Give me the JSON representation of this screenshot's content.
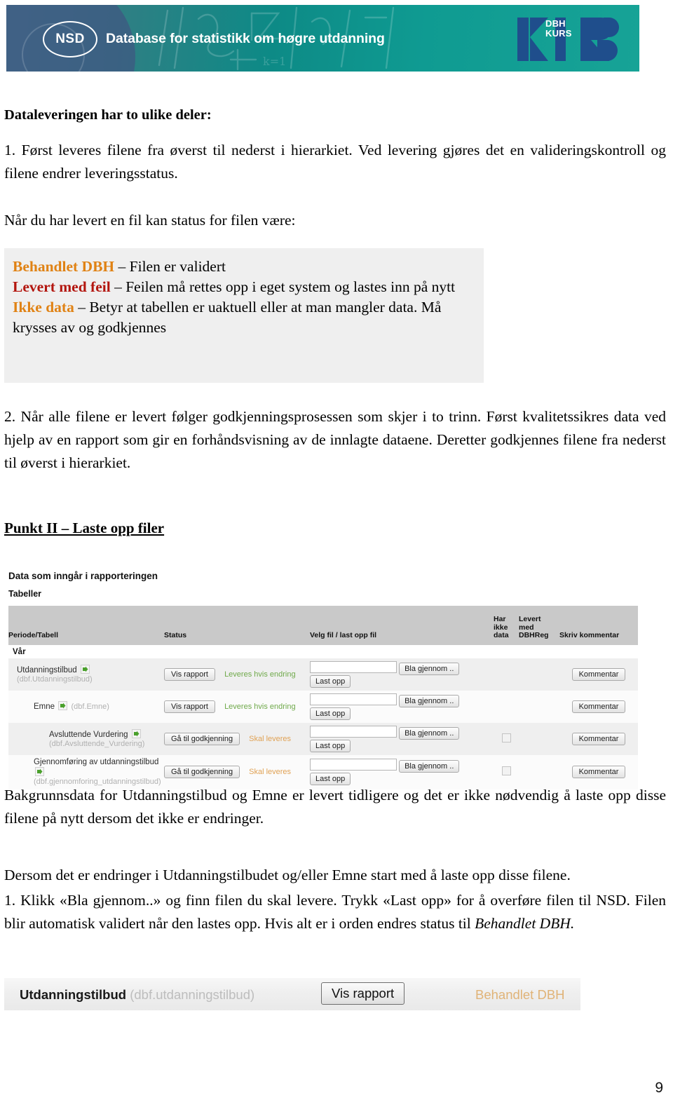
{
  "banner": {
    "logo_initials": "NSD",
    "title": "Database for statistikk om høgre utdanning",
    "kurs_line1": "DBH",
    "kurs_line2": "KURS",
    "kurs_mark": "KURS",
    "colors": {
      "teal_left": "#3c7f8a",
      "teal_right": "#17a396",
      "logo_blue": "#1f4e8c"
    }
  },
  "document": {
    "heading": "Dataleveringen har to ulike deler:",
    "item1": "1. Først leveres filene fra øverst til nederst i hierarkiet. Ved levering gjøres det en valideringskontroll og filene endrer leveringsstatus.",
    "intro_status": "Når du har levert en fil kan status for filen være:",
    "statuses": [
      {
        "label": "Behandlet DBH",
        "color": "#E08214",
        "dash": " – ",
        "desc": "Filen er validert"
      },
      {
        "label": "Levert med feil",
        "color": "#B3160F",
        "dash": " – ",
        "desc": "Feilen må rettes opp i eget system og lastes inn på nytt"
      },
      {
        "label": "Ikke data",
        "color": "#E08214",
        "dash": " – ",
        "desc": "Betyr at tabellen er uaktuell eller at man mangler data. Må krysses av og godkjennes"
      }
    ],
    "item2": "2. Når alle filene er levert følger godkjenningsprosessen som skjer i to trinn. Først kvalitetssikres data ved hjelp av en rapport som gir en forhåndsvisning av de innlagte dataene. Deretter godkjennes filene fra nederst til øverst i hierarkiet.",
    "punkt_heading": "Punkt II – Laste opp filer",
    "para_bakgrunn": "Bakgrunnsdata for Utdanningstilbud og Emne er levert tidligere og det er ikke nødvendig å laste opp disse filene på nytt dersom det ikke er endringer.",
    "para_dersom": "Dersom det er endringer i Utdanningstilbudet og/eller Emne start med å laste opp disse filene.",
    "para_klikk_1": "1. Klikk «Bla gjennom..» og finn filen du skal levere. Trykk «Last opp» for å overføre filen til NSD. Filen blir automatisk validert når den lastes opp. Hvis alt er i orden endres status til ",
    "para_klikk_italic": "Behandlet DBH.",
    "page_number": "9"
  },
  "app_screenshot": {
    "title": "Data som inngår i rapporteringen",
    "subtitle": "Tabeller",
    "columns": {
      "periode": "Periode/Tabell",
      "status": "Status",
      "velg": "Velg fil / last opp fil",
      "har_ikke_data": "Har\nikke\ndata",
      "har_ikke_data_l1": "Har",
      "har_ikke_data_l2": "ikke",
      "har_ikke_data_l3": "data",
      "levert_l1": "Levert",
      "levert_l2": "med",
      "levert_l3": "DBHReg",
      "skriv": "Skriv kommentar"
    },
    "group": "Vår",
    "rows": [
      {
        "name": "Utdanningstilbud",
        "dbf": "(dbf.Utdanningstilbud)",
        "indent": 1,
        "has_arrow": true,
        "action_button": "Vis rapport",
        "status": "Leveres hvis endring",
        "status_color": "#6fa94a",
        "browse_button": "Bla gjennom ..",
        "upload_button": "Last opp",
        "checkbox": false,
        "comment_button": "Kommentar",
        "shaded": true,
        "inline_dbf": false
      },
      {
        "name": "Emne",
        "dbf": "(dbf.Emne)",
        "indent": 2,
        "has_arrow": true,
        "action_button": "Vis rapport",
        "status": "Leveres hvis endring",
        "status_color": "#6fa94a",
        "browse_button": "Bla gjennom ..",
        "upload_button": "Last opp",
        "checkbox": false,
        "comment_button": "Kommentar",
        "shaded": false,
        "inline_dbf": true
      },
      {
        "name": "Avsluttende Vurdering",
        "dbf": "(dbf.Avsluttende_Vurdering)",
        "indent": 3,
        "has_arrow": true,
        "action_button": "Gå til godkjenning",
        "status": "Skal leveres",
        "status_color": "#e0a255",
        "browse_button": "Bla gjennom ..",
        "upload_button": "Last opp",
        "checkbox": true,
        "comment_button": "Kommentar",
        "shaded": true,
        "inline_dbf": false
      },
      {
        "name": "Gjennomføring av utdanningstilbud",
        "dbf": "(dbf.gjennomforing_utdanningstilbud)",
        "indent": 4,
        "has_arrow": true,
        "action_button": "Gå til godkjenning",
        "status": "Skal leveres",
        "status_color": "#e0a255",
        "browse_button": "Bla gjennom ..",
        "upload_button": "Last opp",
        "checkbox": true,
        "comment_button": "Kommentar",
        "shaded": false,
        "inline_dbf": false
      }
    ]
  },
  "bottom_strip": {
    "name": "Utdanningstilbud",
    "dbf": "(dbf.utdanningstilbud)",
    "button": "Vis rapport",
    "status": "Behandlet DBH",
    "status_color": "#e0b377"
  }
}
